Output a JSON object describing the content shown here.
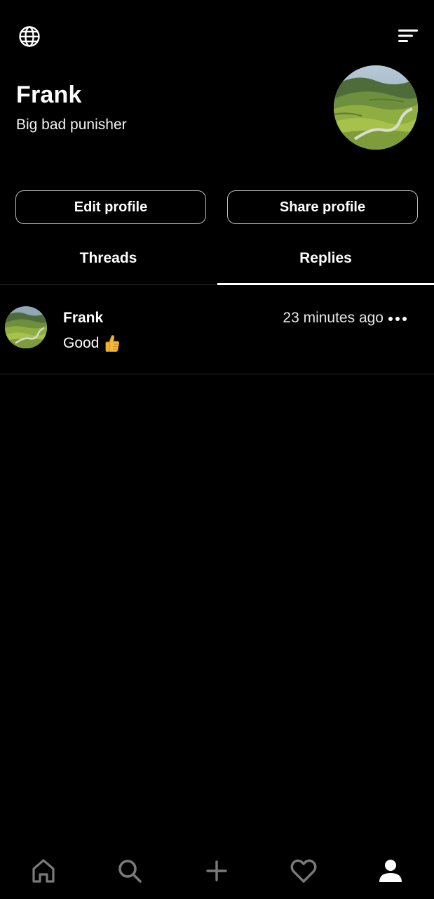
{
  "header": {
    "left_icon": "globe-icon",
    "right_icon": "sort-menu-icon"
  },
  "profile": {
    "name": "Frank",
    "bio": "Big bad punisher"
  },
  "actions": {
    "edit_label": "Edit profile",
    "share_label": "Share profile"
  },
  "tabs": [
    {
      "label": "Threads",
      "active": false
    },
    {
      "label": "Replies",
      "active": true
    }
  ],
  "replies": [
    {
      "author": "Frank",
      "time": "23 minutes ago",
      "text": "Good",
      "emoji": "thumbs-up-icon"
    }
  ],
  "bottom_nav": [
    {
      "name": "home-icon",
      "active": false
    },
    {
      "name": "search-icon",
      "active": false
    },
    {
      "name": "plus-icon",
      "active": false
    },
    {
      "name": "heart-icon",
      "active": false
    },
    {
      "name": "profile-icon",
      "active": true
    }
  ],
  "colors": {
    "background": "#000000",
    "text": "#ffffff",
    "border": "#bdbdbd",
    "divider": "#2a2a2a",
    "inactive_icon": "#7a7a7a"
  }
}
